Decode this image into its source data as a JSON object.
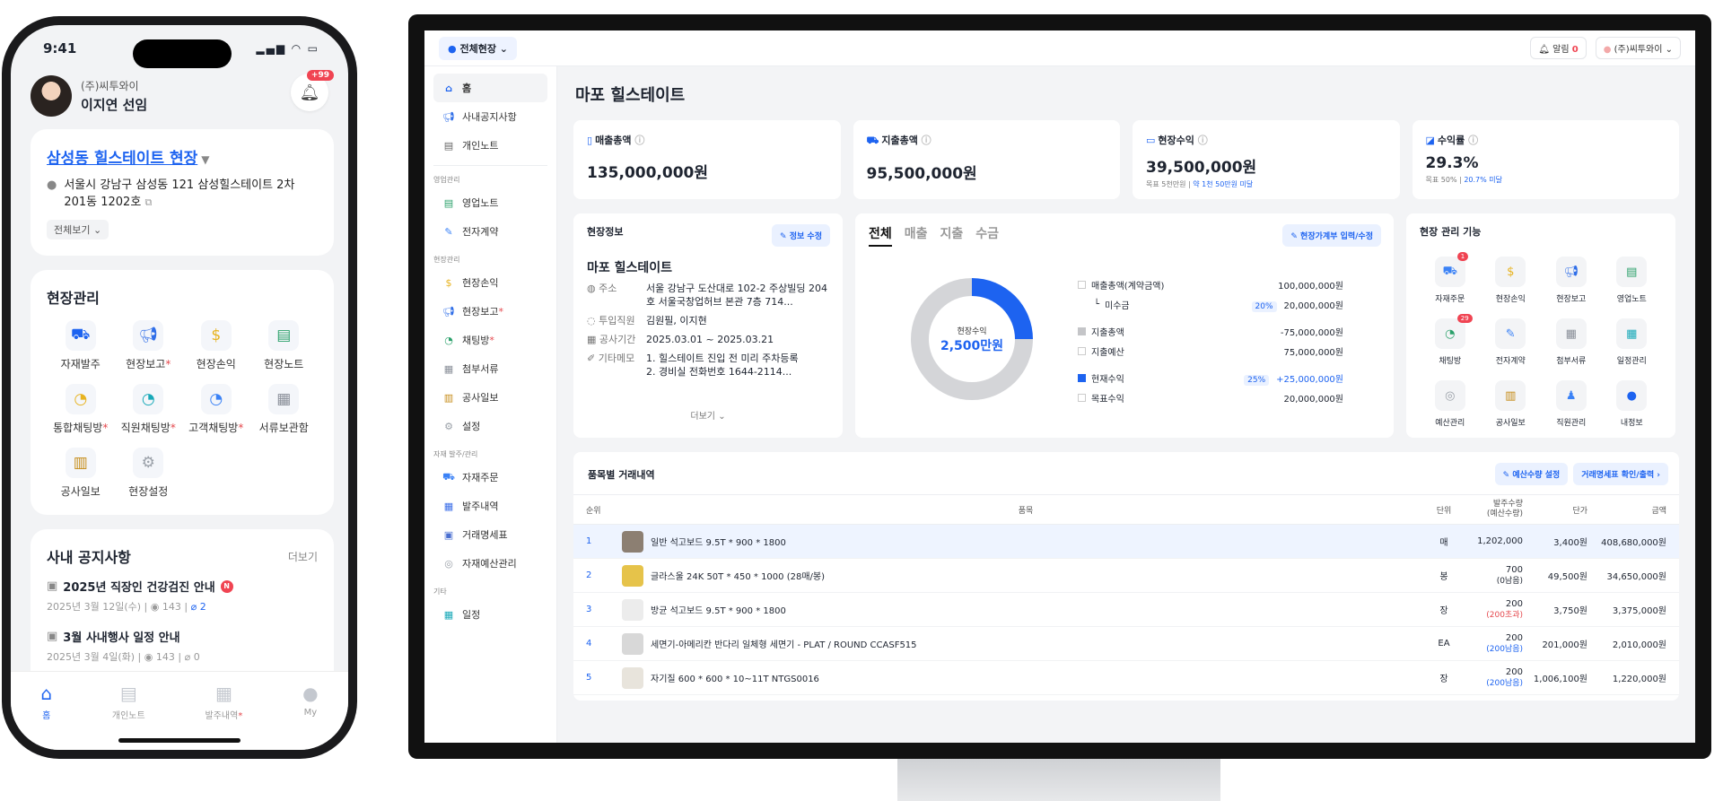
{
  "phone": {
    "status": {
      "time": "9:41"
    },
    "profile": {
      "company": "(주)씨투와이",
      "name": "이지연 선임",
      "notif_badge": "+99"
    },
    "site": {
      "name": "삼성동 힐스테이트 현장",
      "address_line1": "서울시 강남구 삼성동 121 삼성힐스테이트 2차",
      "address_line2": "201동 1202호",
      "view_all": "전체보기"
    },
    "management": {
      "title": "현장관리",
      "items": [
        {
          "label": "자재발주",
          "icon": "truck-icon",
          "dot": false
        },
        {
          "label": "현장보고",
          "icon": "megaphone-icon",
          "dot": true
        },
        {
          "label": "현장손익",
          "icon": "money-bag-icon",
          "dot": false
        },
        {
          "label": "현장노트",
          "icon": "notebook-icon",
          "dot": false
        },
        {
          "label": "통합채팅방",
          "icon": "chat-yellow-icon",
          "dot": true
        },
        {
          "label": "직원채팅방",
          "icon": "chat-teal-icon",
          "dot": true
        },
        {
          "label": "고객채팅방",
          "icon": "chat-blue-icon",
          "dot": true
        },
        {
          "label": "서류보관함",
          "icon": "document-icon",
          "dot": false
        },
        {
          "label": "공사일보",
          "icon": "barrier-icon",
          "dot": false
        },
        {
          "label": "현장설정",
          "icon": "gear-icon",
          "dot": false
        }
      ]
    },
    "notices": {
      "title": "사내 공지사항",
      "more": "더보기",
      "items": [
        {
          "title": "2025년 직장인 건강검진 안내",
          "new_badge": "N",
          "date": "2025년 3월 12일(수)",
          "views": "143",
          "attachments": "2"
        },
        {
          "title": "3월 사내행사 일정 안내",
          "date": "2025년 3월 4일(화)",
          "views": "143",
          "attachments": "0"
        }
      ]
    },
    "tabbar": [
      {
        "label": "홈",
        "icon": "home-icon"
      },
      {
        "label": "개인노트",
        "icon": "note-icon"
      },
      {
        "label": "발주내역",
        "icon": "order-list-icon"
      },
      {
        "label": "My",
        "icon": "person-icon"
      }
    ]
  },
  "desktop": {
    "topbar": {
      "site_select": "전체현장",
      "alarm_label": "알림",
      "alarm_count": "0",
      "company": "(주)씨투와이"
    },
    "sidebar": {
      "top": [
        {
          "label": "홈",
          "icon": "home-icon"
        },
        {
          "label": "사내공지사항",
          "icon": "megaphone-icon"
        },
        {
          "label": "개인노트",
          "icon": "note-icon"
        }
      ],
      "group_sales": "영업관리",
      "sales": [
        {
          "label": "영업노트",
          "icon": "notebook-icon"
        },
        {
          "label": "전자계약",
          "icon": "pen-icon"
        }
      ],
      "group_site": "현장관리",
      "site": [
        {
          "label": "현장손익",
          "icon": "money-bag-icon"
        },
        {
          "label": "현장보고",
          "icon": "megaphone-icon"
        },
        {
          "label": "채팅방",
          "icon": "chat-icon"
        },
        {
          "label": "첨부서류",
          "icon": "document-icon"
        },
        {
          "label": "공사일보",
          "icon": "barrier-icon"
        },
        {
          "label": "설정",
          "icon": "gear-icon"
        }
      ],
      "group_material": "자재 발주/관리",
      "material": [
        {
          "label": "자재주문",
          "icon": "cart-icon"
        },
        {
          "label": "발주내역",
          "icon": "order-list-icon"
        },
        {
          "label": "거래명세표",
          "icon": "receipt-icon"
        },
        {
          "label": "자재예산관리",
          "icon": "budget-icon"
        }
      ],
      "group_etc": "기타",
      "etc": [
        {
          "label": "일정",
          "icon": "calendar-icon"
        }
      ]
    },
    "page_title": "마포 힐스테이트",
    "stats": [
      {
        "label": "매출총액",
        "value": "135,000,000원"
      },
      {
        "label": "지출총액",
        "value": "95,500,000원"
      },
      {
        "label": "현장수익",
        "value": "39,500,000원",
        "sub1": "목표 5천만원",
        "sub2": "약 1천 50만원 미달"
      },
      {
        "label": "수익률",
        "value": "29.3%",
        "sub1": "목표 50%",
        "sub2": "20.7% 미달"
      }
    ],
    "site_info": {
      "title": "현장정보",
      "edit": "정보 수정",
      "name": "마포 힐스테이트",
      "address_label": "주소",
      "address": "서울 강남구 도산대로 102-2 주상빌딩 204호 서울국창업허브 본관 7층 714...",
      "staff_label": "투입직원",
      "staff": "김원필, 이지현",
      "period_label": "공사기간",
      "period": "2025.03.01 ~ 2025.03.21",
      "memo_label": "기타메모",
      "memo1": "1. 힐스테이트 진입 전 미리 주차등록",
      "memo2": "2. 경비실 전화번호 1644-2114...",
      "more": "더보기"
    },
    "finance": {
      "tabs": [
        "전체",
        "매출",
        "지출",
        "수금"
      ],
      "input_btn": "현장가계부 입력/수정",
      "donut_label": "현장수익",
      "donut_value": "2,500만원",
      "donut_share": 0.25,
      "rows": [
        {
          "label": "매출총액(계약금액)",
          "value": "100,000,000원"
        },
        {
          "label": "미수금",
          "pct": "20%",
          "value": "20,000,000원"
        },
        {
          "label": "지출총액",
          "value": "-75,000,000원"
        },
        {
          "label": "지출예산",
          "value": "75,000,000원"
        },
        {
          "label": "현재수익",
          "pct": "25%",
          "value": "+25,000,000원"
        },
        {
          "label": "목표수익",
          "value": "20,000,000원"
        }
      ]
    },
    "functions": {
      "title": "현장 관리 기능",
      "items": [
        {
          "label": "자재주문",
          "icon": "cart-icon",
          "badge": "1"
        },
        {
          "label": "현장손익",
          "icon": "money-bag-icon"
        },
        {
          "label": "현장보고",
          "icon": "megaphone-icon"
        },
        {
          "label": "영업노트",
          "icon": "notebook-icon"
        },
        {
          "label": "채팅방",
          "icon": "chat-icon",
          "badge": "29"
        },
        {
          "label": "전자계약",
          "icon": "pen-icon"
        },
        {
          "label": "첨부서류",
          "icon": "document-icon"
        },
        {
          "label": "일정관리",
          "icon": "calendar-icon"
        },
        {
          "label": "예산관리",
          "icon": "budget-icon"
        },
        {
          "label": "공사일보",
          "icon": "barrier-icon"
        },
        {
          "label": "직원관리",
          "icon": "staff-icon"
        },
        {
          "label": "내정보",
          "icon": "person-icon"
        }
      ]
    },
    "table": {
      "title": "품목별 거래내역",
      "btn_budget": "예산수량 설정",
      "btn_statement": "거래명세표 확인/출력",
      "headers": {
        "no": "순위",
        "item": "품목",
        "unit": "단위",
        "qty": "발주수량",
        "qty_sub": "(예산수량)",
        "price": "단가",
        "amount": "금액"
      },
      "rows": [
        {
          "no": "1",
          "name": "일반 석고보드 9.5T * 900 * 1800",
          "unit": "매",
          "qty": "1,202,000",
          "qty_sub": "",
          "price": "3,400원",
          "amount": "408,680,000원"
        },
        {
          "no": "2",
          "name": "글라스울 24K 50T * 450 * 1000 (28매/봉)",
          "unit": "봉",
          "qty": "700",
          "qty_sub": "(0남음)",
          "price": "49,500원",
          "amount": "34,650,000원"
        },
        {
          "no": "3",
          "name": "방균 석고보드 9.5T * 900 * 1800",
          "unit": "장",
          "qty": "200",
          "qty_sub": "(200초과)",
          "price": "3,750원",
          "amount": "3,375,000원"
        },
        {
          "no": "4",
          "name": "세면기-아메리칸 반다리 일체형 세면기 - PLAT / ROUND CCASF515",
          "unit": "EA",
          "qty": "200",
          "qty_sub": "(200남음)",
          "price": "201,000원",
          "amount": "2,010,000원"
        },
        {
          "no": "5",
          "name": "자기질 600 * 600 * 10~11T NTGS0016",
          "unit": "장",
          "qty": "200",
          "qty_sub": "(200남음)",
          "price": "1,006,100원",
          "amount": "1,220,000원"
        }
      ]
    }
  }
}
